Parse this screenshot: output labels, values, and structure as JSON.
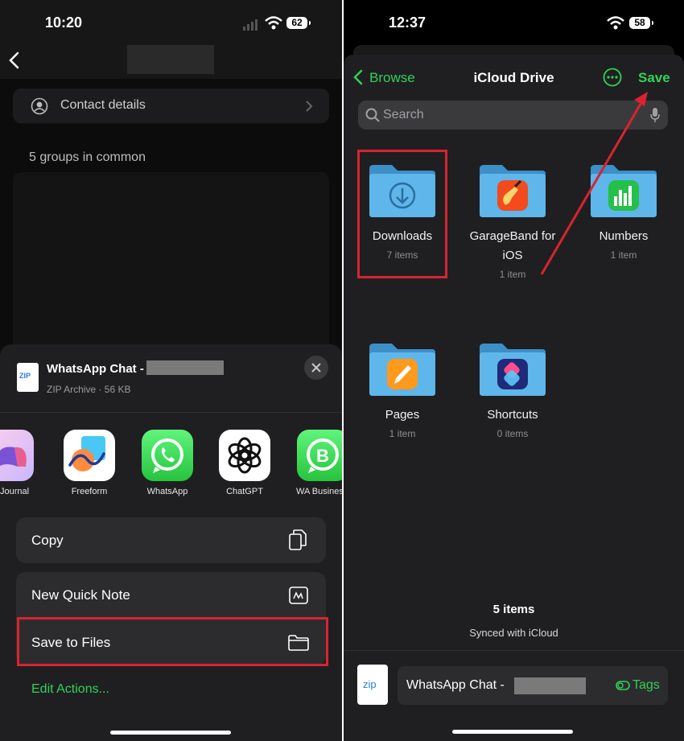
{
  "left": {
    "status": {
      "time": "10:20",
      "battery": "62"
    },
    "contact_details_label": "Contact details",
    "groups_in_common": "5 groups in common",
    "share": {
      "title": "WhatsApp Chat -",
      "subtitle": "ZIP Archive · 56 KB",
      "file_icon_text": "ZIP",
      "apps": [
        {
          "label": "Journal"
        },
        {
          "label": "Freeform"
        },
        {
          "label": "WhatsApp"
        },
        {
          "label": "ChatGPT"
        },
        {
          "label": "WA Business"
        }
      ],
      "actions": {
        "copy": "Copy",
        "new_quick_note": "New Quick Note",
        "save_to_files": "Save to Files",
        "edit_actions": "Edit Actions..."
      }
    }
  },
  "right": {
    "status": {
      "time": "12:37",
      "battery": "58"
    },
    "nav": {
      "back": "Browse",
      "title": "iCloud Drive",
      "save": "Save"
    },
    "search": {
      "placeholder": "Search"
    },
    "folders": [
      {
        "name": "Downloads",
        "count": "7 items"
      },
      {
        "name": "GarageBand for iOS",
        "count": "1 item"
      },
      {
        "name": "Numbers",
        "count": "1 item"
      },
      {
        "name": "Pages",
        "count": "1 item"
      },
      {
        "name": "Shortcuts",
        "count": "0 items"
      }
    ],
    "footer": {
      "count": "5 items",
      "sync": "Synced with iCloud"
    },
    "bottom": {
      "file_icon_text": "zip",
      "filename": "WhatsApp Chat -",
      "tags": "Tags"
    }
  },
  "colors": {
    "accent_green": "#30d158",
    "highlight_red": "#d9232f",
    "folder_blue": "#5fb6ea"
  }
}
